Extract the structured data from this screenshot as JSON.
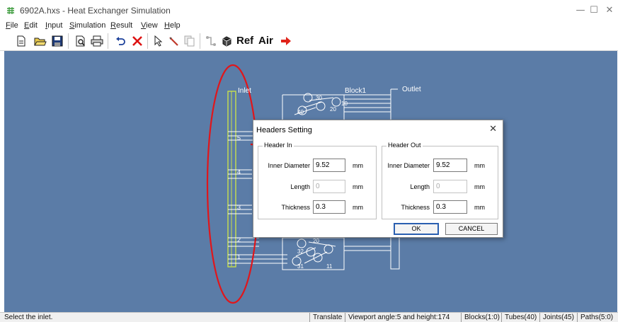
{
  "window": {
    "title": "6902A.hxs - Heat Exchanger Simulation",
    "minimize": "—",
    "maximize": "☐",
    "close": "✕"
  },
  "menu": [
    {
      "label": "File",
      "u": "F",
      "rest": "ile"
    },
    {
      "label": "Edit",
      "u": "E",
      "rest": "dit"
    },
    {
      "label": "Input",
      "u": "I",
      "rest": "nput"
    },
    {
      "label": "Simulation",
      "u": "S",
      "rest": "imulation"
    },
    {
      "label": "Result",
      "u": "R",
      "rest": "esult"
    },
    {
      "label": "View",
      "u": "V",
      "rest": "iew"
    },
    {
      "label": "Help",
      "u": "H",
      "rest": "elp"
    }
  ],
  "toolbar": {
    "ref_label": "Ref",
    "air_label": "Air"
  },
  "canvas": {
    "inlet_label": "Inlet",
    "outlet_label": "Outlet",
    "block_label": "Block1",
    "inlet_numbers": [
      "5",
      "4",
      "3",
      "2",
      "1"
    ],
    "tube_numbers": [
      "30",
      "20",
      "40",
      "10",
      "20",
      "32",
      "31",
      "11"
    ]
  },
  "dialog": {
    "title": "Headers Setting",
    "close": "✕",
    "header_in": {
      "title": "Header In",
      "inner_diameter_label": "Inner Diameter",
      "inner_diameter": "9.52",
      "length_label": "Length",
      "length": "0",
      "thickness_label": "Thickness",
      "thickness": "0.3",
      "unit": "mm"
    },
    "header_out": {
      "title": "Header Out",
      "inner_diameter_label": "Inner Diameter",
      "inner_diameter": "9.52",
      "length_label": "Length",
      "length": "0",
      "thickness_label": "Thickness",
      "thickness": "0.3",
      "unit": "mm"
    },
    "ok_label": "OK",
    "cancel_label": "CANCEL"
  },
  "status": {
    "message": "Select the inlet.",
    "mode": "Translate",
    "viewport": "Viewport angle:5 and height:174",
    "blocks": "Blocks(1:0)",
    "tubes": "Tubes(40)",
    "joints": "Joints(45)",
    "paths": "Paths(5:0)"
  },
  "colors": {
    "viewport_bg": "#5b7ca7",
    "annotation_red": "#e0161b",
    "inlet_header": "#c9e04c",
    "drawing_line": "#ffffff"
  }
}
